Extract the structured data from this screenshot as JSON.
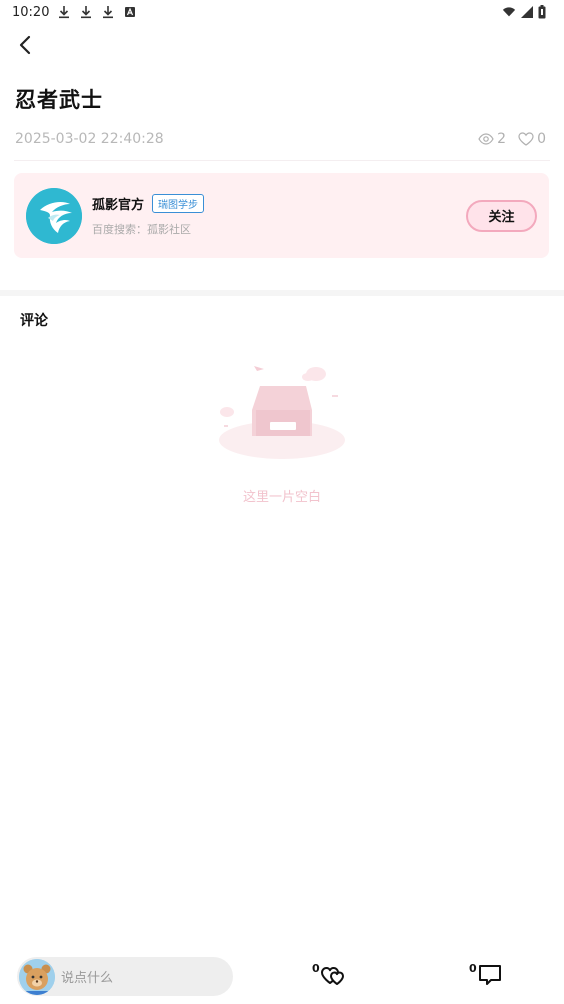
{
  "status_bar": {
    "time": "10:20"
  },
  "post": {
    "title": "忍者武士",
    "datetime": "2025-03-02 22:40:28",
    "views": "2",
    "likes": "0"
  },
  "author": {
    "name": "孤影官方",
    "tag": "瑞图学步",
    "subtitle": "百度搜索：孤影社区",
    "follow_label": "关注"
  },
  "comments": {
    "title": "评论",
    "empty_text": "这里一片空白"
  },
  "bottom_bar": {
    "input_placeholder": "说点什么",
    "like_count": "0",
    "comment_count": "0"
  },
  "colors": {
    "accent_pink": "#f3a9bd",
    "card_bg": "#fff0f2",
    "tag_blue": "#3a8fd6",
    "avatar_teal": "#39c7d8"
  }
}
